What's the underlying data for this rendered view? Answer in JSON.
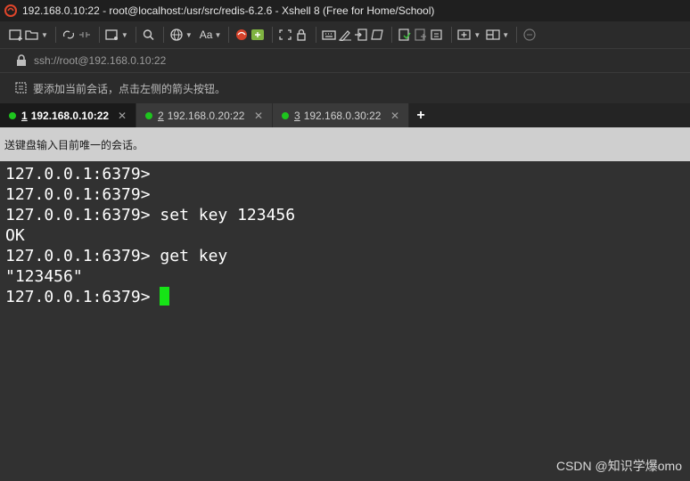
{
  "window": {
    "title": "192.168.0.10:22 - root@localhost:/usr/src/redis-6.2.6 - Xshell 8 (Free for Home/School)"
  },
  "toolbar": {
    "font_button_label": "Aa",
    "icons": [
      "new-session-icon",
      "open-folder-icon",
      "reconnect-icon",
      "disconnect-icon",
      "new-window-icon",
      "find-icon",
      "globe-icon",
      "font-icon",
      "xshell-logo-icon",
      "xftp-icon",
      "fullscreen-icon",
      "lock-icon",
      "keyboard-icon",
      "highlight-icon",
      "transfer-icon",
      "script-icon",
      "log-icon",
      "options-icon",
      "compose-icon",
      "add-tab-icon",
      "layout-icon",
      "help-icon"
    ]
  },
  "address": {
    "url": "ssh://root@192.168.0.10:22"
  },
  "session_bar": {
    "hint": "要添加当前会话，点击左侧的箭头按钮。"
  },
  "tabs": [
    {
      "num": "1",
      "label": "192.168.0.10:22",
      "active": true
    },
    {
      "num": "2",
      "label": "192.168.0.20:22",
      "active": false
    },
    {
      "num": "3",
      "label": "192.168.0.30:22",
      "active": false
    }
  ],
  "tab_close_glyph": "✕",
  "new_tab_glyph": "+",
  "broadcast": {
    "text": "送键盘输入目前唯一的会话。"
  },
  "terminal": {
    "lines": [
      "127.0.0.1:6379>",
      "127.0.0.1:6379>",
      "127.0.0.1:6379> set key 123456",
      "OK",
      "127.0.0.1:6379> get key",
      "\"123456\"",
      "127.0.0.1:6379> "
    ],
    "cursor_color": "#16e316"
  },
  "watermark": "CSDN @知识学爆omo"
}
